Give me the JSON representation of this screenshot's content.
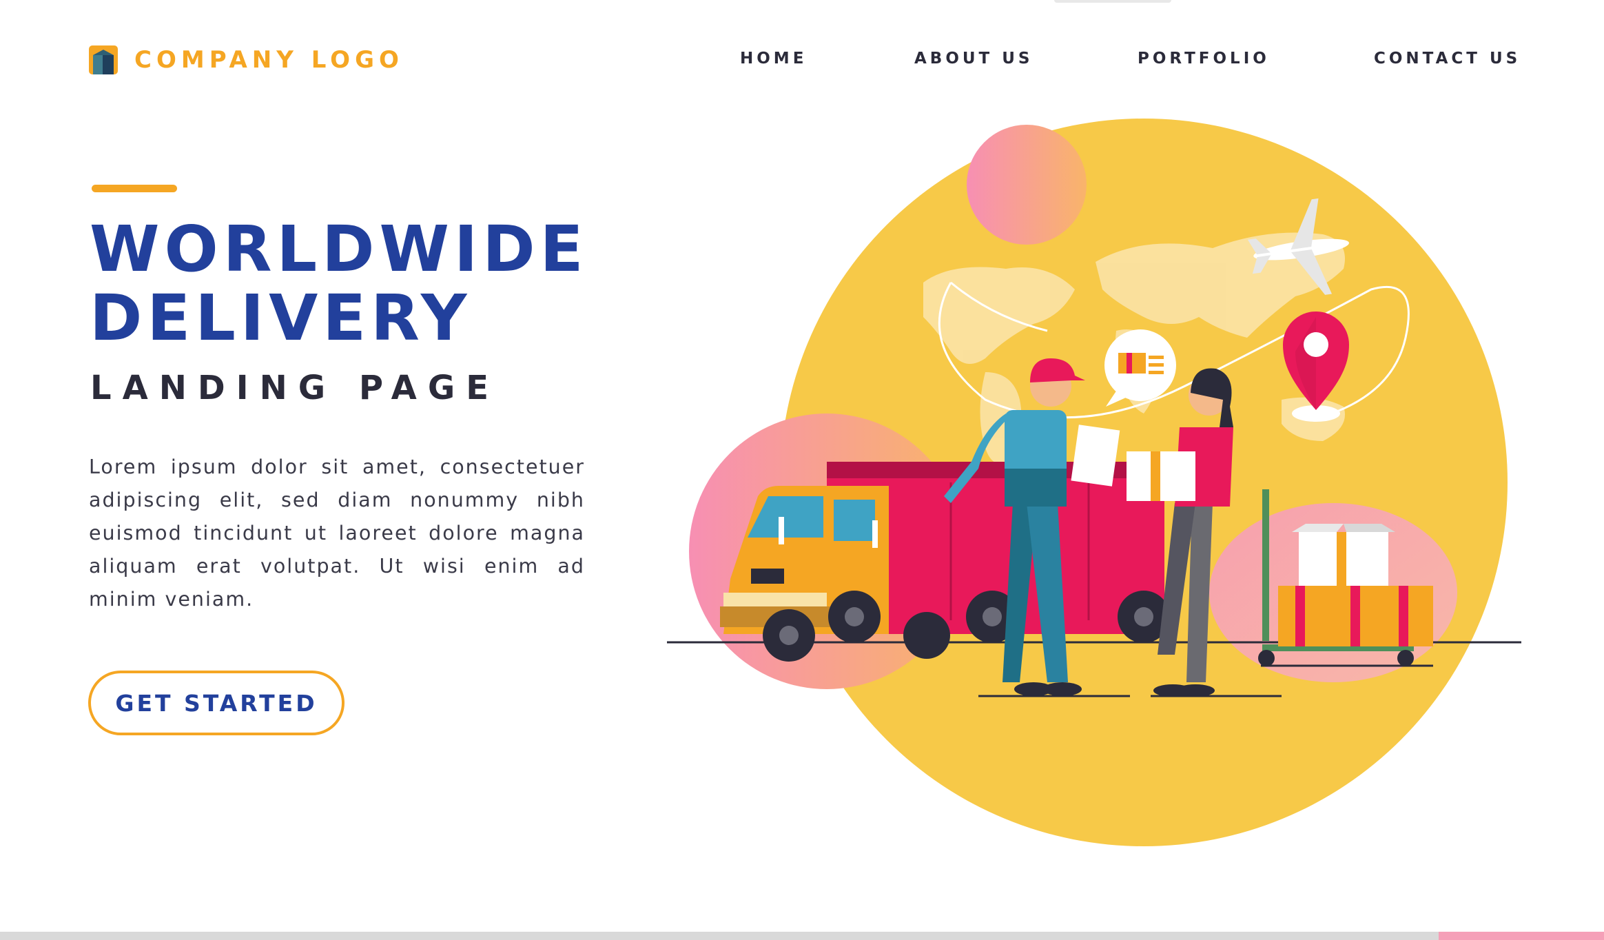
{
  "header": {
    "logo_text": "COMPANY LOGO",
    "nav": [
      {
        "label": "HOME"
      },
      {
        "label": "ABOUT US"
      },
      {
        "label": "PORTFOLIO"
      },
      {
        "label": "CONTACT US"
      }
    ]
  },
  "hero": {
    "title_line1": "WORLDWIDE",
    "title_line2": "DELIVERY",
    "subtitle": "LANDING PAGE",
    "body": "Lorem ipsum dolor sit amet, consectetuer adipiscing elit, sed diam nonummy nibh euismod tincidunt ut laoreet dolore magna aliquam erat volutpat. Ut wisi enim ad minim veniam.",
    "cta_label": "GET STARTED"
  },
  "illustration": {
    "icons": [
      "world-map",
      "airplane-icon",
      "location-pin-icon",
      "delivery-truck",
      "courier-man",
      "customer-woman",
      "parcel-box",
      "hand-cart",
      "chat-bubble-truck-icon"
    ]
  },
  "colors": {
    "brand_yellow": "#f5a623",
    "brand_blue": "#22409c",
    "circle_yellow": "#f7c948",
    "pink": "#f58fb0",
    "truck_red": "#e8195a"
  }
}
